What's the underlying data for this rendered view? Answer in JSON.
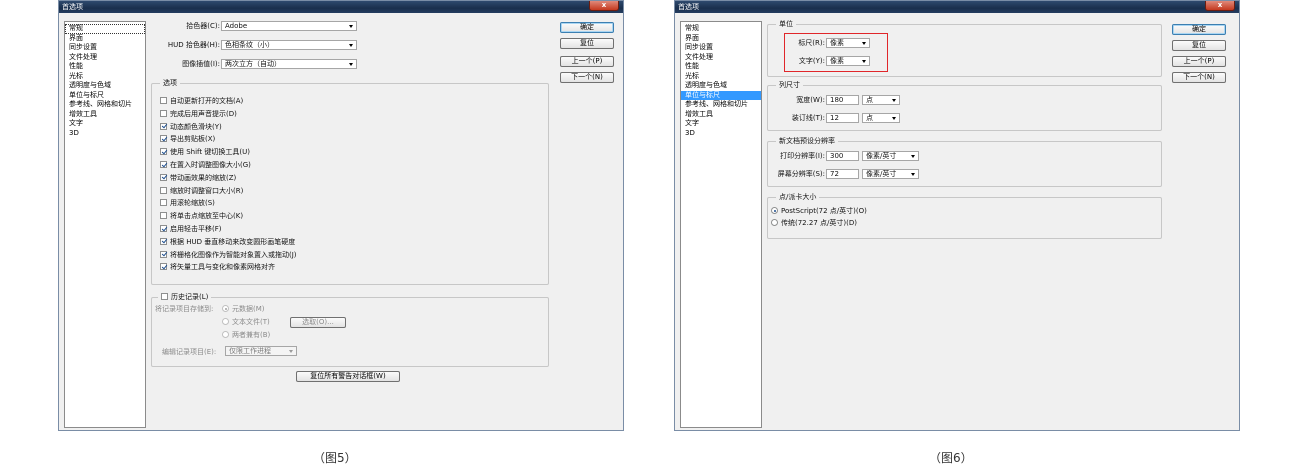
{
  "left": {
    "title": "首选项",
    "close": "x",
    "sidebar": [
      "常规",
      "界面",
      "同步设置",
      "文件处理",
      "性能",
      "光标",
      "透明度与色域",
      "单位与标尺",
      "参考线、网格和切片",
      "增效工具",
      "文字",
      "3D"
    ],
    "buttons": {
      "ok": "确定",
      "reset": "复位",
      "prev": "上一个(P)",
      "next": "下一个(N)"
    },
    "color_picker": {
      "label": "拾色器(C):",
      "value": "Adobe"
    },
    "hud_picker": {
      "label": "HUD 拾色器(H):",
      "value": "色相条纹（小）"
    },
    "interpolation": {
      "label": "图像插值(I):",
      "value": "两次立方（自动）"
    },
    "options": {
      "title": "选项",
      "items": [
        {
          "label": "自动更新打开的文档(A)",
          "checked": false
        },
        {
          "label": "完成后用声音提示(D)",
          "checked": false
        },
        {
          "label": "动态颜色滑块(Y)",
          "checked": true
        },
        {
          "label": "导出剪贴板(X)",
          "checked": true
        },
        {
          "label": "使用 Shift 键切换工具(U)",
          "checked": true
        },
        {
          "label": "在置入时调整图像大小(G)",
          "checked": true
        },
        {
          "label": "带动画效果的缩放(Z)",
          "checked": true
        },
        {
          "label": "缩放时调整窗口大小(R)",
          "checked": false
        },
        {
          "label": "用滚轮缩放(S)",
          "checked": false
        },
        {
          "label": "将单击点缩放至中心(K)",
          "checked": false
        },
        {
          "label": "启用轻击平移(F)",
          "checked": true
        },
        {
          "label": "根据 HUD 垂直移动来改变圆形画笔硬度",
          "checked": true
        },
        {
          "label": "将栅格化图像作为智能对象置入或拖动(J)",
          "checked": true
        },
        {
          "label": "将矢量工具与变化和像素网格对齐",
          "checked": true
        }
      ]
    },
    "history": {
      "title": "历史记录(L)",
      "save_to_label": "将记录项目存储到:",
      "radios": [
        "元数据(M)",
        "文本文件(T)",
        "两者兼有(B)"
      ],
      "choose_button": "选取(O)...",
      "edit_label": "编辑记录项目(E):",
      "edit_value": "仅限工作进程"
    },
    "reset_warnings": "复位所有警告对话框(W)",
    "caption": "（图5）"
  },
  "right": {
    "title": "首选项",
    "close": "x",
    "sidebar": [
      "常规",
      "界面",
      "同步设置",
      "文件处理",
      "性能",
      "光标",
      "透明度与色域",
      "单位与标尺",
      "参考线、网格和切片",
      "增效工具",
      "文字",
      "3D"
    ],
    "buttons": {
      "ok": "确定",
      "reset": "复位",
      "prev": "上一个(P)",
      "next": "下一个(N)"
    },
    "units": {
      "title": "单位",
      "ruler_label": "标尺(R):",
      "ruler_value": "像素",
      "type_label": "文字(Y):",
      "type_value": "像素"
    },
    "column": {
      "title": "列尺寸",
      "width_label": "宽度(W):",
      "width_value": "180",
      "width_unit": "点",
      "gutter_label": "装订线(T):",
      "gutter_value": "12",
      "gutter_unit": "点"
    },
    "resolution": {
      "title": "新文档预设分辨率",
      "print_label": "打印分辨率(I):",
      "print_value": "300",
      "print_unit": "像素/英寸",
      "screen_label": "屏幕分辨率(S):",
      "screen_value": "72",
      "screen_unit": "像素/英寸"
    },
    "point": {
      "title": "点/派卡大小",
      "postscript": "PostScript(72 点/英寸)(O)",
      "traditional": "传统(72.27 点/英寸)(D)"
    },
    "caption": "（图6）"
  }
}
